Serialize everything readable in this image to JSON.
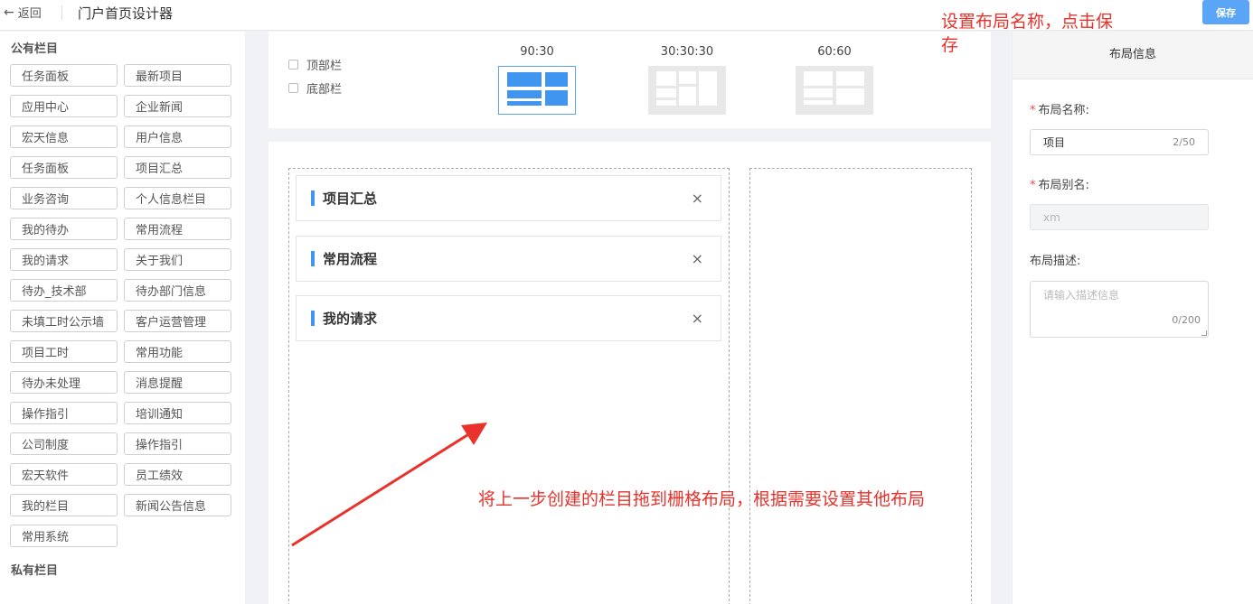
{
  "header": {
    "back_label": "返回",
    "title": "门户首页设计器",
    "save_label": "保存"
  },
  "sidebar": {
    "public_title": "公有栏目",
    "private_title": "私有栏目",
    "items": [
      "任务面板",
      "最新项目",
      "应用中心",
      "企业新闻",
      "宏天信息",
      "用户信息",
      "任务面板",
      "项目汇总",
      "业务咨询",
      "个人信息栏目",
      "我的待办",
      "常用流程",
      "我的请求",
      "关于我们",
      "待办_技术部",
      "待办部门信息",
      "未填工时公示墙",
      "客户运营管理",
      "项目工时",
      "常用功能",
      "待办未处理",
      "消息提醒",
      "操作指引",
      "培训通知",
      "公司制度",
      "操作指引",
      "宏天软件",
      "员工绩效",
      "我的栏目",
      "新闻公告信息",
      "常用系统"
    ]
  },
  "options": {
    "top_bar": "顶部栏",
    "bottom_bar": "底部栏",
    "layouts": [
      "90:30",
      "30:30:30",
      "60:60"
    ],
    "selected_layout": "90:30"
  },
  "grid": {
    "cards": [
      "项目汇总",
      "常用流程",
      "我的请求"
    ],
    "close_icon": "×"
  },
  "form": {
    "panel_title": "布局信息",
    "name_label": "布局名称:",
    "name_value": "项目",
    "name_count": "2/50",
    "alias_label": "布局别名:",
    "alias_value": "xm",
    "desc_label": "布局描述:",
    "desc_placeholder": "请输入描述信息",
    "desc_count": "0/200"
  },
  "annotations": {
    "top": "设置布局名称，点击保存",
    "middle": "将上一步创建的栏目拖到栅格布局，根据需要设置其他布局"
  },
  "colors": {
    "accent": "#3f95f0",
    "annotation": "#e8322b"
  }
}
